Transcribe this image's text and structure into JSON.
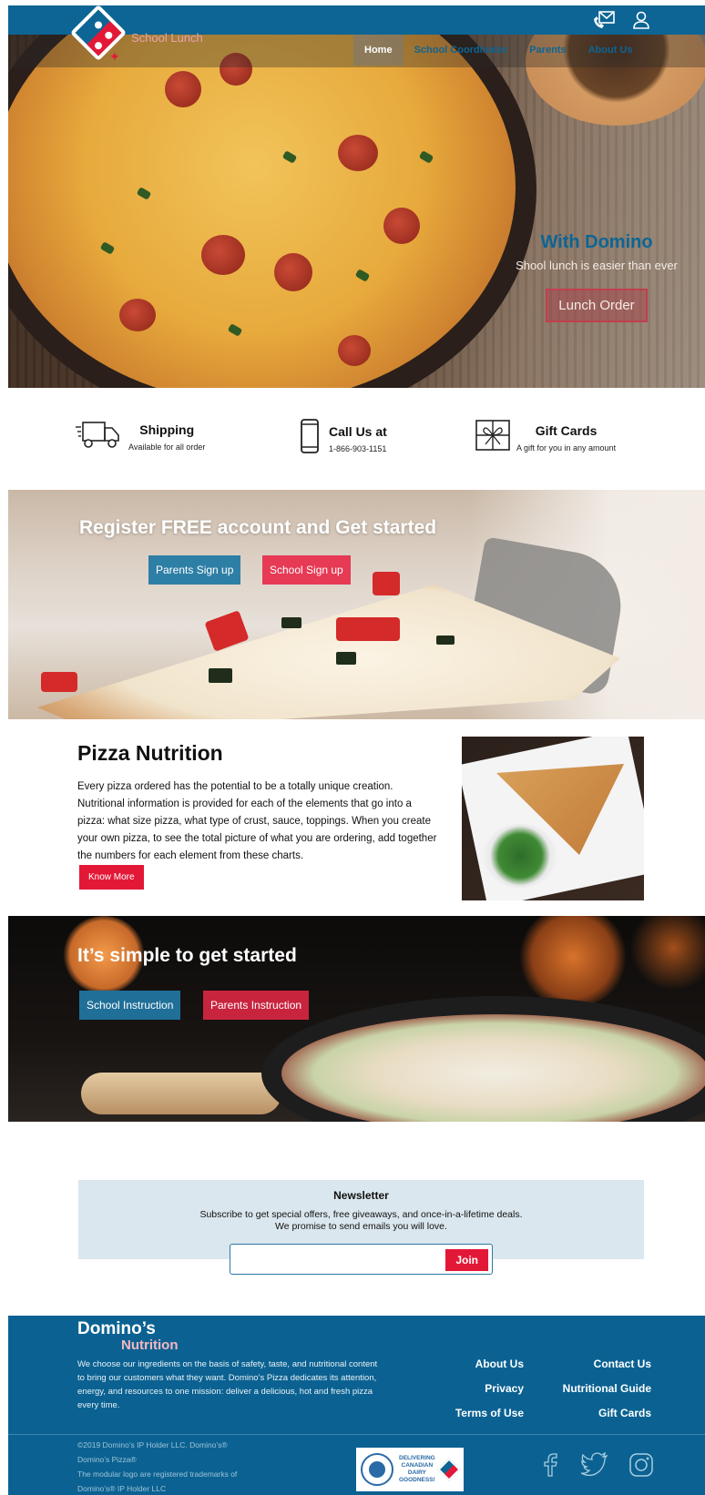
{
  "header": {
    "icons": [
      "mail-phone-icon",
      "user-icon"
    ]
  },
  "logo": {
    "brand": "Domino’s",
    "sub": "School Lunch"
  },
  "nav": {
    "items": [
      "Home",
      "School Coordinator",
      "Parents",
      "About Us"
    ],
    "active": "Home"
  },
  "hero": {
    "heading": "With Domino",
    "subtext": "Shool lunch is easier than ever",
    "cta": "Lunch Order"
  },
  "features": [
    {
      "icon": "truck-icon",
      "title": "Shipping",
      "sub": "Available for all order"
    },
    {
      "icon": "phone-icon",
      "title": "Call Us at",
      "sub": "1-866-903-1151"
    },
    {
      "icon": "gift-icon",
      "title": "Gift Cards",
      "sub": "A gift for you in any amount"
    }
  ],
  "register": {
    "heading": "Register FREE account and Get started",
    "parents_btn": "Parents Sign up",
    "school_btn": "School Sign up"
  },
  "nutrition": {
    "heading": "Pizza Nutrition",
    "body": "Every pizza ordered has the potential to be a totally unique creation. Nutritional information is provided for each of the elements that go into a pizza: what size pizza, what type of crust, sauce, toppings. When you create your own pizza, to see the total picture of what you are ordering, add together the numbers for each element from these charts.",
    "button": "Know More"
  },
  "simple": {
    "heading": "It’s simple to get started",
    "school_btn": "School Instruction",
    "parents_btn": "Parents Instruction"
  },
  "newsletter": {
    "title": "Newsletter",
    "line1": "Subscribe to get special offers, free giveaways, and once-in-a-lifetime deals.",
    "line2": "We promise to send emails you will love.",
    "input_value": "",
    "join": "Join"
  },
  "footer": {
    "brand": "Domino’s",
    "brand2": "Nutrition",
    "about": "We choose our ingredients on the basis of safety, taste, and nutritional content to bring our customers what they want. Domino’s Pizza dedicates its attention, energy, and resources to one mission: deliver a delicious, hot and fresh pizza every time.",
    "links": [
      "About Us",
      "Contact Us",
      "Privacy",
      "Nutritional Guide",
      "Terms of Use",
      "Gift Cards"
    ],
    "copyright": [
      "©2019 Domino’s IP Holder LLC. Domino’s®",
      "Domino’s Pizza®",
      "The modular logo are registered trademarks of",
      "Domino’s® IP Holder LLC"
    ],
    "badge": [
      "DELIVERING",
      "CANADIAN",
      "DAIRY",
      "GOODNESS!"
    ],
    "social": [
      "facebook-icon",
      "twitter-icon",
      "instagram-icon"
    ]
  },
  "colors": {
    "brand_blue": "#0c6594",
    "brand_red": "#e31837",
    "footer_blue": "#0b6292",
    "newsletter_bg": "#dbe7ee"
  }
}
